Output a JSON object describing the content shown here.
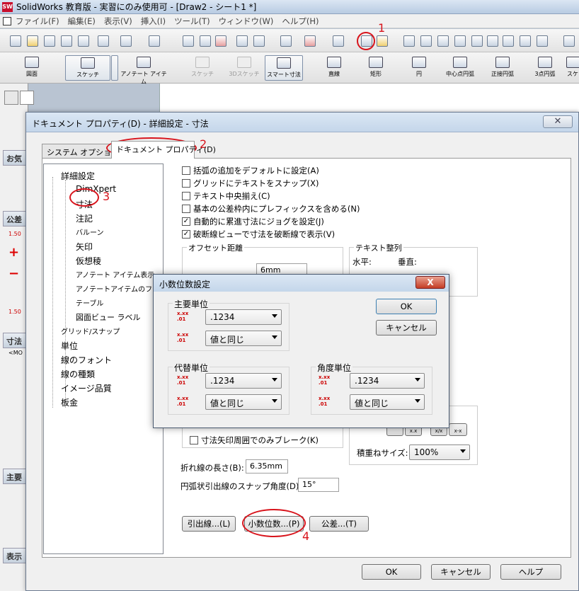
{
  "app": {
    "title": "SolidWorks 教育版 - 実習にのみ使用可 - [Draw2 - シート1 *]",
    "logo": "SW"
  },
  "menu": [
    "ファイル(F)",
    "編集(E)",
    "表示(V)",
    "挿入(I)",
    "ツール(T)",
    "ウィンドウ(W)",
    "ヘルプ(H)"
  ],
  "toolbar2": [
    {
      "label": "図面",
      "icon": "drawing-icon"
    },
    {
      "label": "スケッチ",
      "icon": "sketch-icon"
    },
    {
      "label": "アノテート アイテム",
      "icon": "annotation-icon"
    },
    {
      "label": "スケッチ",
      "icon": "sketch-disabled-icon"
    },
    {
      "label": "3Dスケッチ",
      "icon": "3d-sketch-icon"
    },
    {
      "label": "スマート寸法",
      "icon": "smart-dimension-icon"
    },
    {
      "label": "直線",
      "icon": "line-icon"
    },
    {
      "label": "矩形",
      "icon": "rectangle-icon"
    },
    {
      "label": "円",
      "icon": "circle-icon"
    },
    {
      "label": "中心点円弧",
      "icon": "center-arc-icon"
    },
    {
      "label": "正接円弧",
      "icon": "tangent-arc-icon"
    },
    {
      "label": "3点円弧",
      "icon": "3point-arc-icon"
    },
    {
      "label": "スケ",
      "icon": "sketch-more-icon"
    }
  ],
  "leftpanel": {
    "headers": [
      "お気",
      "公差",
      "寸法",
      "主要",
      "表示"
    ],
    "mo": "<MO",
    "num1": "1.50",
    "num2": "1.50"
  },
  "dialog": {
    "title": "ドキュメント プロパティ(D) - 詳細設定 - 寸法",
    "close": "✕",
    "tabs": [
      "システム オプション(S)",
      "ドキュメント プロパティ(D)"
    ],
    "tree": [
      "詳細設定",
      "DimXpert",
      "寸法",
      "注記",
      "バルーン",
      "矢印",
      "仮想稜",
      "アノテート アイテム表示",
      "アノテートアイテムのフォント",
      "テーブル",
      "図面ビュー ラベル",
      "グリッド/スナップ",
      "単位",
      "線のフォント",
      "線の種類",
      "イメージ品質",
      "板金"
    ],
    "checks": [
      {
        "label": "括弧の追加をデフォルトに設定(A)",
        "checked": false
      },
      {
        "label": "グリッドにテキストをスナップ(X)",
        "checked": false
      },
      {
        "label": "テキスト中央揃え(C)",
        "checked": false
      },
      {
        "label": "基本の公差枠内にプレフィックスを含める(N)",
        "checked": false
      },
      {
        "label": "自動的に累進寸法にジョグを設定(J)",
        "checked": true
      },
      {
        "label": "破断線ビューで寸法を破断線で表示(V)",
        "checked": true
      }
    ],
    "offset_label": "オフセット距離",
    "offset_value": "6mm",
    "text_align_label": "テキスト整列",
    "horizontal": "水平:",
    "vertical": "垂直:",
    "break_only": "寸法矢印周囲でのみブレーク(K)",
    "stack_size_label": "積重ねサイズ:",
    "stack_size_value": "100%",
    "bent_length_label": "折れ線の長さ(B):",
    "bent_length_value": "6.35mm",
    "arc_snap_label": "円弧状引出線のスナップ角度(D):",
    "arc_snap_value": "15°",
    "leader_btn": "引出線...(L)",
    "decimal_btn": "小数位数...(P)",
    "tolerance_btn": "公差...(T)",
    "ok": "OK",
    "cancel": "キャンセル",
    "help": "ヘルプ"
  },
  "sub": {
    "title": "小数位数設定",
    "close": "X",
    "primary_label": "主要単位",
    "primary_value1": ".1234",
    "primary_value2": "値と同じ",
    "alt_label": "代替単位",
    "alt_value1": ".1234",
    "alt_value2": "値と同じ",
    "angle_label": "角度単位",
    "angle_value1": ".1234",
    "angle_value2": "値と同じ",
    "ok": "OK",
    "cancel": "キャンセル"
  },
  "annotations": [
    "1",
    "2",
    "3",
    "4"
  ],
  "colors": {
    "annotation": "#d8141c"
  }
}
